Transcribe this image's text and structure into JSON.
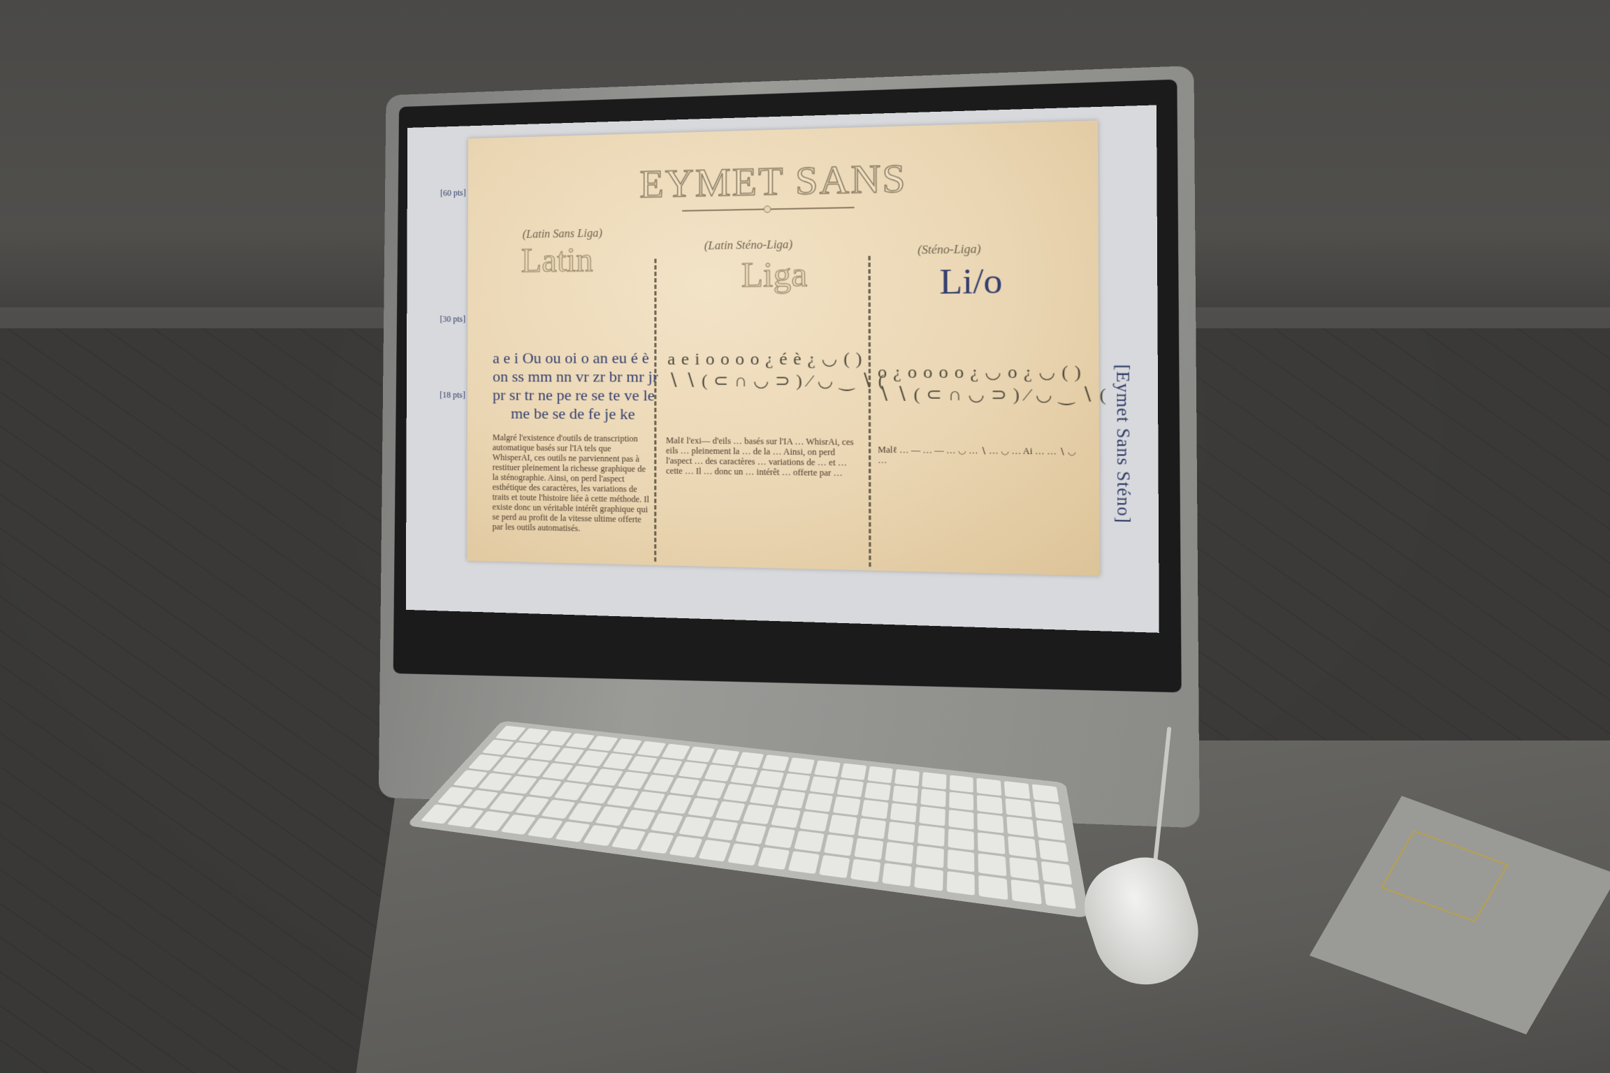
{
  "screen": {
    "size_labels": [
      "[60 pts]",
      "[30 pts]",
      "[18 pts]"
    ],
    "side_caption": "[Eymet Sans Sténo]",
    "card": {
      "title": "EYMET SANS",
      "columns": [
        {
          "subtitle": "(Latin Sans Liga)",
          "heading": "Latin",
          "rows": [
            "a e i Ou ou oi o an eu é è",
            "on ss mm nn vr zr br mr jr",
            "pr sr tr ne pe re se te ve le",
            "me be se de fe je ke"
          ],
          "paragraph": "Malgré l'existence d'outils de transcription automatique basés sur l'IA tels que WhisperAI, ces outils ne parviennent pas à restituer pleinement la richesse graphique de la sténographie. Ainsi, on perd l'aspect esthétique des caractères, les variations de traits et toute l'histoire liée à cette méthode. Il existe donc un véritable intérêt graphique qui se perd au profit de la vitesse ultime offerte par les outils automatisés."
        },
        {
          "subtitle": "(Latin Sténo-Liga)",
          "heading": "Liga",
          "rows": [
            "a e i o o o o ¿ é è ¿ ◡ ( )",
            "∖ ∖ ( ⊂ ∩ ◡ ⊃ ) ⁄ ◡ ‿ ∖ ("
          ],
          "paragraph": "Malℓ l'exi— d'eils … basés sur l'IA … WhisrAi, ces eils … pleinement la … de la … Ainsi, on perd l'aspect … des caractères … variations de … et … cette … Il … donc un … intérêt … offerte par …"
        },
        {
          "subtitle": "(Sténo-Liga)",
          "heading": "Li/o",
          "rows": [
            "o ¿ o o o o ¿ ◡ o ¿ ◡ ( )",
            "∖ ∖ ( ⊂ ∩ ◡ ⊃ ) ⁄ ◡ ‿ ∖ ("
          ],
          "paragraph": "Malℓ … — … — … ◡ … ∖ … ◡ … Ai … … ∖ ◡ …"
        }
      ]
    }
  },
  "hardware": {
    "chin_logo": ""
  }
}
